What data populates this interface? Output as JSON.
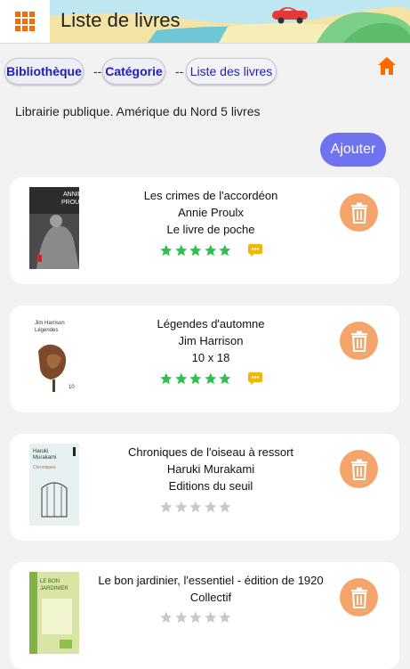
{
  "header": {
    "title": "Liste de livres"
  },
  "breadcrumb": {
    "items": [
      "Bibliothèque",
      "Catégorie",
      "Liste des livres"
    ],
    "separator": "--"
  },
  "info": "Librairie publique. Amérique du Nord 5 livres",
  "add_label": "Ajouter",
  "colors": {
    "accent": "#6f74ee",
    "delete": "#f5a56a",
    "star_on": "#2ec24a",
    "star_off": "#c9c9c9",
    "chat": "#f2b705",
    "home": "#ff6a00"
  },
  "books": [
    {
      "title": "Les crimes de l'accordéon",
      "author": "Annie Proulx",
      "publisher": "Le livre de poche",
      "rating": 5,
      "has_comments": true
    },
    {
      "title": "Légendes d'automne",
      "author": "Jim Harrison",
      "publisher": "10 x 18",
      "rating": 5,
      "has_comments": true
    },
    {
      "title": "Chroniques de l'oiseau à ressort",
      "author": "Haruki Murakami",
      "publisher": "Editions du seuil",
      "rating": 0,
      "has_comments": false
    },
    {
      "title": "Le bon jardinier, l'essentiel - édition de 1920",
      "author": "Collectif",
      "publisher": "",
      "rating": 0,
      "has_comments": false
    }
  ]
}
